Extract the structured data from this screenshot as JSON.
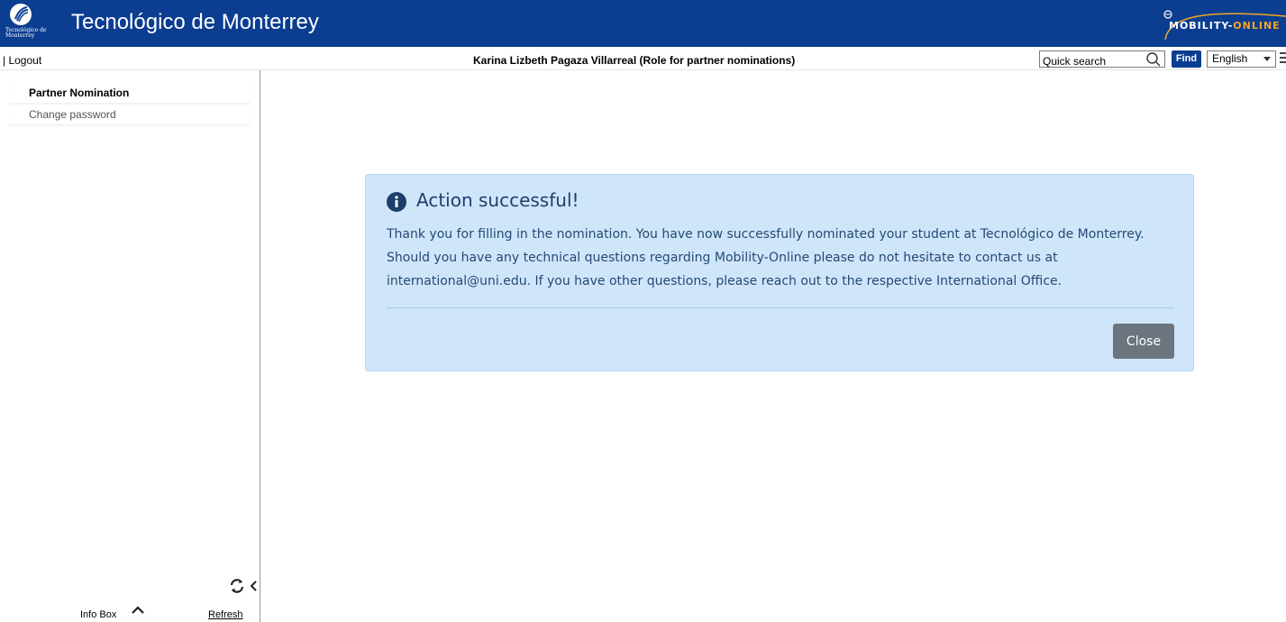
{
  "header": {
    "logo_text": "Tecnológico de Monterrey",
    "title": "Tecnológico de Monterrey",
    "mobility_logo_part1": "MOBILITY-",
    "mobility_logo_part2": "ONLINE"
  },
  "topbar": {
    "logout_label": "| Logout",
    "user_label": "Karina Lizbeth Pagaza Villarreal (Role for partner nominations)",
    "search_placeholder": "Quick search",
    "find_label": "Find",
    "language": "English"
  },
  "sidebar": {
    "items": [
      {
        "label": "Partner Nomination"
      },
      {
        "label": "Change password"
      }
    ],
    "infobox_label": "Info Box",
    "refresh_label": "Refresh"
  },
  "alert": {
    "title": "Action successful!",
    "message": "Thank you for filling in the nomination. You have now successfully nominated your student at Tecnológico de Monterrey. Should you have any technical questions regarding Mobility-Online please do not hesitate to contact us at international@uni.edu. If you have other questions, please reach out to the respective International Office.",
    "close_label": "Close"
  },
  "colors": {
    "header_bg": "#0b3d91",
    "alert_bg": "#cfe6fa",
    "alert_text": "#264a74",
    "close_button": "#6c757d",
    "mobility_accent": "#f5a623"
  },
  "icons": [
    "tec-logo-icon",
    "mobility-online-logo-icon",
    "search-icon",
    "dropdown-arrow-icon",
    "hamburger-menu-icon",
    "refresh-icon",
    "collapse-chevron-icon",
    "chevron-up-icon",
    "info-icon"
  ]
}
